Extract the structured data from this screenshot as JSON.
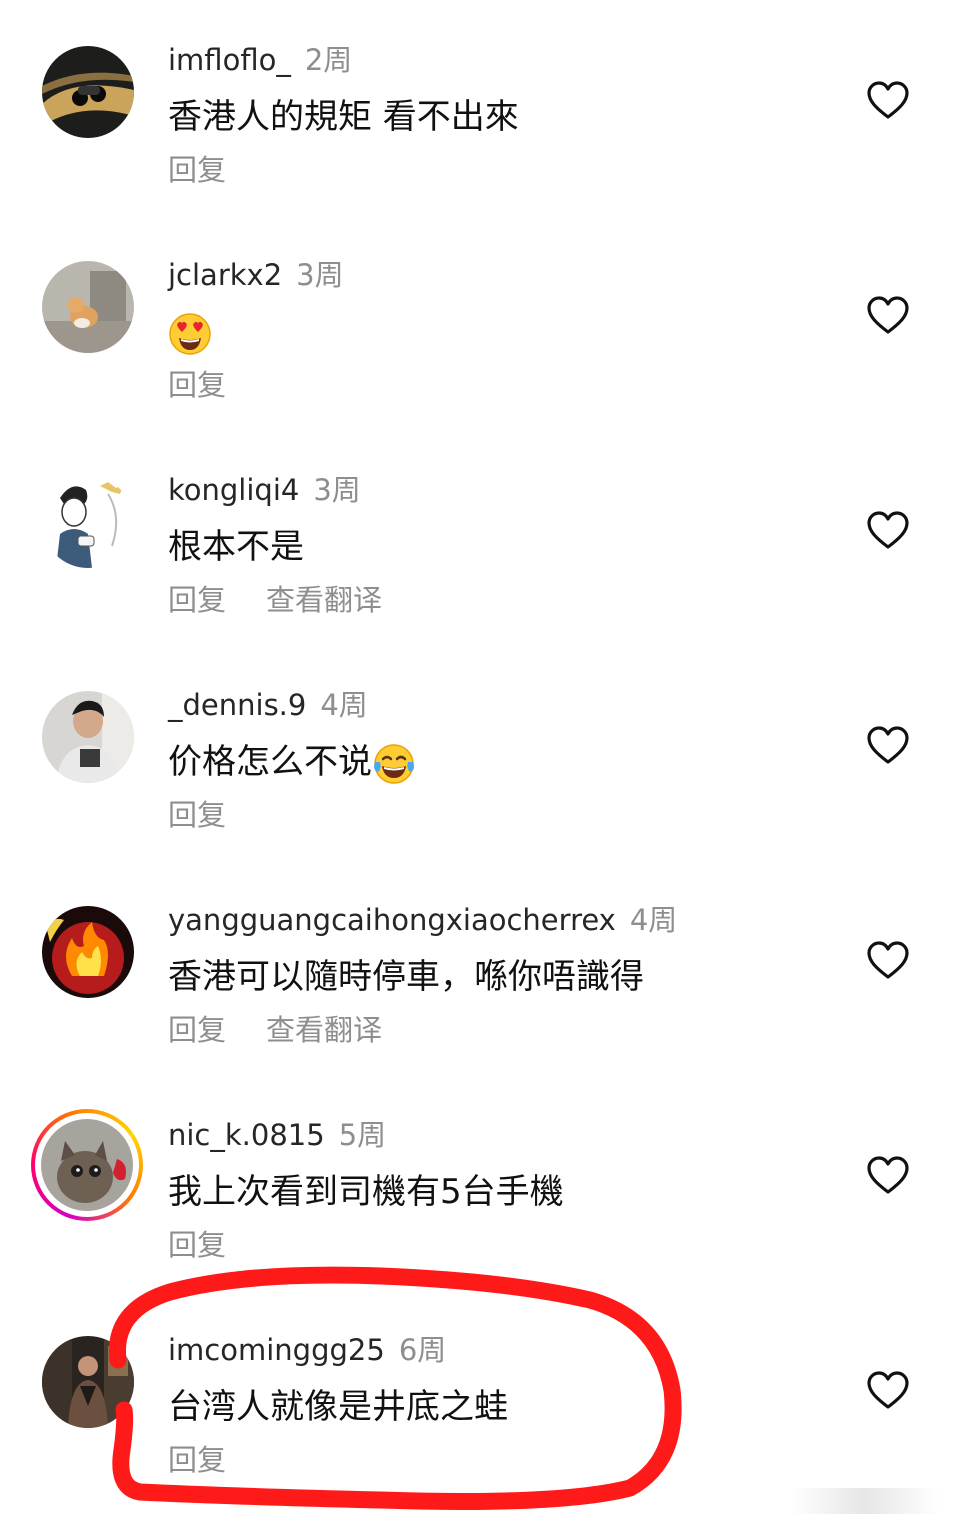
{
  "colors": {
    "username": "#262626",
    "secondary": "#8e8e8e",
    "text": "#111111",
    "highlight_stroke": "#ff1a1a"
  },
  "comments": [
    {
      "username": "imfloflo_",
      "time": "2周",
      "text": "香港人的規矩 看不出來",
      "reply": "回复",
      "avatar_icon": "motorcycle-avatar"
    },
    {
      "username": "jclarkx2",
      "time": "3周",
      "text": "",
      "emoji": "heart-eyes-emoji",
      "reply": "回复",
      "avatar_icon": "dog-photo-avatar"
    },
    {
      "username": "kongliqi4",
      "time": "3周",
      "text": "根本不是",
      "reply": "回复",
      "translate": "查看翻译",
      "avatar_icon": "cartoon-avatar"
    },
    {
      "username": "_dennis.9",
      "time": "4周",
      "text": "价格怎么不说",
      "emoji": "tears-of-joy-emoji",
      "reply": "回复",
      "avatar_icon": "person-photo-avatar"
    },
    {
      "username": "yangguangcaihongxiaocherrex",
      "time": "4周",
      "text": "香港可以隨時停車，喺你唔識得",
      "reply": "回复",
      "translate": "查看翻译",
      "avatar_icon": "fire-avatar"
    },
    {
      "username": "nic_k.0815",
      "time": "5周",
      "text": "我上次看到司機有5台手機",
      "reply": "回复",
      "avatar_icon": "cat-photo-avatar",
      "story_ring": true
    },
    {
      "username": "imcominggg25",
      "time": "6周",
      "text": "台湾人就像是井底之蛙",
      "reply": "回复",
      "avatar_icon": "street-photo-avatar",
      "highlighted": true
    }
  ]
}
